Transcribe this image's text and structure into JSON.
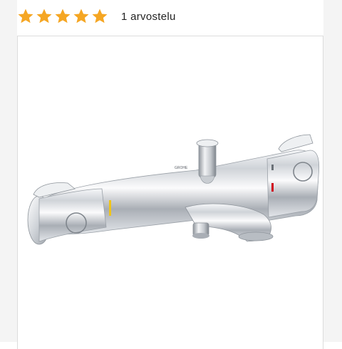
{
  "rating": {
    "stars_filled": 5,
    "stars_total": 5,
    "star_color": "#f5a623",
    "count_label": "1 arvostelu"
  },
  "product_image": {
    "subject": "chrome thermostatic bath mixer faucet",
    "brand_mark": "GROHE",
    "accent_hot": "#d0021b",
    "accent_indicator": "#f0c419"
  }
}
